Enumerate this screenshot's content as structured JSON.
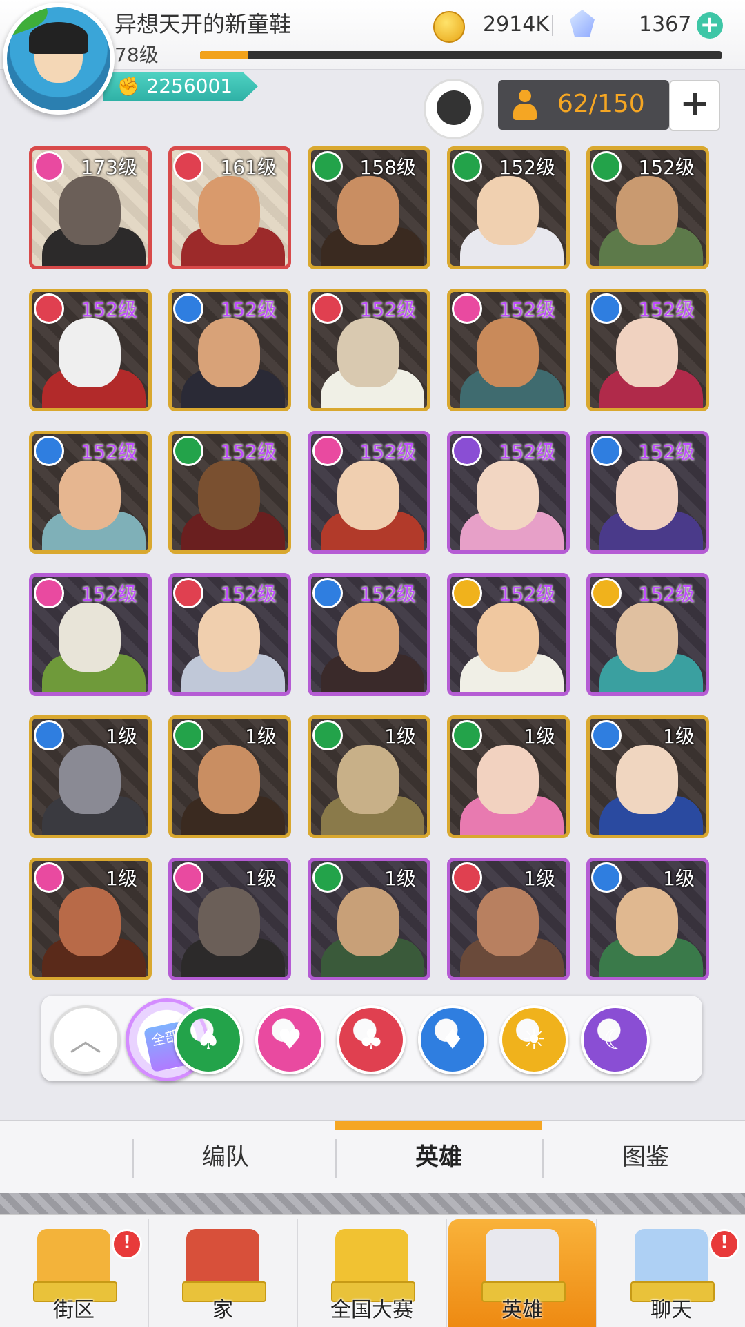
{
  "player": {
    "name": "异想天开的新童鞋",
    "level": "78级",
    "xp_fraction": 0.092,
    "power": "2256001"
  },
  "currency": {
    "coins": "2914K",
    "gems": "1367"
  },
  "hero_count": "62/150",
  "heroes": [
    {
      "level": "173级",
      "faction": "heart",
      "frame": "red",
      "skin": "#6b5f58",
      "outfit": "#2c2a2a",
      "purple_level": false
    },
    {
      "level": "161级",
      "faction": "club",
      "frame": "red",
      "skin": "#d99a6c",
      "outfit": "#9c2a2a",
      "purple_level": false
    },
    {
      "level": "158级",
      "faction": "spade",
      "frame": "gold",
      "skin": "#c98e62",
      "outfit": "#3a2a20",
      "purple_level": false
    },
    {
      "level": "152级",
      "faction": "spade",
      "frame": "gold",
      "skin": "#f0d0b0",
      "outfit": "#e8e8ee",
      "purple_level": false
    },
    {
      "level": "152级",
      "faction": "spade",
      "frame": "gold",
      "skin": "#c99a70",
      "outfit": "#5d7a4a",
      "purple_level": false
    },
    {
      "level": "152级",
      "faction": "club",
      "frame": "gold",
      "skin": "#efefef",
      "outfit": "#b22a2a",
      "purple_level": true
    },
    {
      "level": "152级",
      "faction": "diamond",
      "frame": "gold",
      "skin": "#d8a278",
      "outfit": "#2a2a36",
      "purple_level": true
    },
    {
      "level": "152级",
      "faction": "club",
      "frame": "gold",
      "skin": "#d9c9b0",
      "outfit": "#f0f0e6",
      "purple_level": true
    },
    {
      "level": "152级",
      "faction": "heart",
      "frame": "gold",
      "skin": "#c98a5a",
      "outfit": "#3f6b6f",
      "purple_level": true
    },
    {
      "level": "152级",
      "faction": "diamond",
      "frame": "gold",
      "skin": "#f0d2c0",
      "outfit": "#b02a4a",
      "purple_level": true
    },
    {
      "level": "152级",
      "faction": "diamond",
      "frame": "gold",
      "skin": "#e6b690",
      "outfit": "#7fb0b8",
      "purple_level": true
    },
    {
      "level": "152级",
      "faction": "spade",
      "frame": "gold",
      "skin": "#7a5030",
      "outfit": "#6a1f1f",
      "purple_level": true
    },
    {
      "level": "152级",
      "faction": "heart",
      "frame": "purple",
      "skin": "#f0cfb0",
      "outfit": "#b23a2a",
      "purple_level": true
    },
    {
      "level": "152级",
      "faction": "moon",
      "frame": "purple",
      "skin": "#f2d6c2",
      "outfit": "#e7a0c8",
      "purple_level": true
    },
    {
      "level": "152级",
      "faction": "diamond",
      "frame": "purple",
      "skin": "#f0d0c0",
      "outfit": "#4a3a8a",
      "purple_level": true
    },
    {
      "level": "152级",
      "faction": "heart",
      "frame": "purple",
      "skin": "#e8e4d8",
      "outfit": "#6f9a3a",
      "purple_level": true
    },
    {
      "level": "152级",
      "faction": "club",
      "frame": "purple",
      "skin": "#f0cfae",
      "outfit": "#c0c8d8",
      "purple_level": true
    },
    {
      "level": "152级",
      "faction": "diamond",
      "frame": "purple",
      "skin": "#d8a478",
      "outfit": "#3a2a2a",
      "purple_level": true
    },
    {
      "level": "152级",
      "faction": "sun",
      "frame": "purple",
      "skin": "#f0c8a0",
      "outfit": "#f0efe6",
      "purple_level": true
    },
    {
      "level": "152级",
      "faction": "sun",
      "frame": "purple",
      "skin": "#e0c0a0",
      "outfit": "#3aa0a0",
      "purple_level": true
    },
    {
      "level": "1级",
      "faction": "diamond",
      "frame": "gold",
      "skin": "#8a8a94",
      "outfit": "#3a3a40",
      "purple_level": false
    },
    {
      "level": "1级",
      "faction": "spade",
      "frame": "gold",
      "skin": "#c98e62",
      "outfit": "#3a2a20",
      "purple_level": false
    },
    {
      "level": "1级",
      "faction": "spade",
      "frame": "gold",
      "skin": "#c8b088",
      "outfit": "#8a7a4a",
      "purple_level": false
    },
    {
      "level": "1级",
      "faction": "spade",
      "frame": "gold",
      "skin": "#f2d2c0",
      "outfit": "#e87ab0",
      "purple_level": false
    },
    {
      "level": "1级",
      "faction": "diamond",
      "frame": "gold",
      "skin": "#f0d6c0",
      "outfit": "#2a4aa0",
      "purple_level": false
    },
    {
      "level": "1级",
      "faction": "heart",
      "frame": "gold",
      "skin": "#b86a48",
      "outfit": "#5a2a1a",
      "purple_level": false
    },
    {
      "level": "1级",
      "faction": "heart",
      "frame": "purple",
      "skin": "#6b5f58",
      "outfit": "#2c2a2a",
      "purple_level": false
    },
    {
      "level": "1级",
      "faction": "spade",
      "frame": "purple",
      "skin": "#c8a078",
      "outfit": "#3a5a3a",
      "purple_level": false
    },
    {
      "level": "1级",
      "faction": "club",
      "frame": "purple",
      "skin": "#b88060",
      "outfit": "#6a4a3a",
      "purple_level": false
    },
    {
      "level": "1级",
      "faction": "diamond",
      "frame": "purple",
      "skin": "#e0b890",
      "outfit": "#3a7a4a",
      "purple_level": false
    }
  ],
  "filters": {
    "all_label": "全部",
    "items": [
      "spade",
      "heart",
      "club",
      "diamond",
      "sun",
      "moon"
    ],
    "colors": {
      "spade": "#23a34a",
      "heart": "#e94aa0",
      "club": "#e04050",
      "diamond": "#2f7ee0",
      "sun": "#f0b21c",
      "moon": "#8a4ed4"
    }
  },
  "subtabs": [
    {
      "label": "编队",
      "active": false
    },
    {
      "label": "英雄",
      "active": true
    },
    {
      "label": "图鉴",
      "active": false
    }
  ],
  "nav": [
    {
      "label": "街区",
      "icon": "signpost-icon",
      "badge": "!",
      "active": false
    },
    {
      "label": "家",
      "icon": "house-icon",
      "badge": "",
      "active": false
    },
    {
      "label": "全国大赛",
      "icon": "trophy-icon",
      "badge": "",
      "active": false
    },
    {
      "label": "英雄",
      "icon": "hero-cards-icon",
      "badge": "",
      "active": true
    },
    {
      "label": "聊天",
      "icon": "chat-bubble-icon",
      "badge": "!",
      "active": false
    }
  ],
  "accent_color": "#f5a623"
}
